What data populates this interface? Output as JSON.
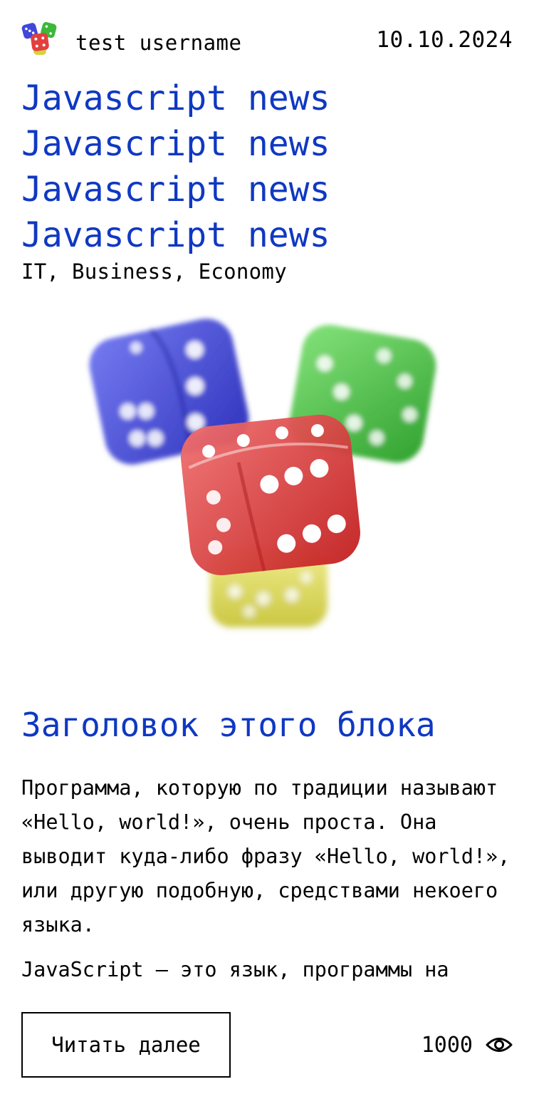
{
  "card": {
    "author": {
      "username": "test username",
      "avatar_icon": "dice-logo-icon"
    },
    "date": "10.10.2024",
    "titles": [
      "Javascript news",
      "Javascript news",
      "Javascript news",
      "Javascript news"
    ],
    "tags": "IT, Business, Economy",
    "image": {
      "icon": "dice-image",
      "colors": [
        "#3a3fd8",
        "#2fb52a",
        "#e43a3a",
        "#d8d43a"
      ]
    },
    "block_title": "Заголовок этого блока",
    "paragraphs": [
      "Программа, которую по традиции называют «Hello, world!», очень проста. Она выводит куда-либо фразу «Hello, world!», или другую подобную, средствами некоего языка.",
      "JavaScript — это язык, программы на"
    ],
    "read_more_label": "Читать далее",
    "views": {
      "count": "1000",
      "icon": "eye-icon"
    },
    "accent_color": "#0f38c2"
  }
}
